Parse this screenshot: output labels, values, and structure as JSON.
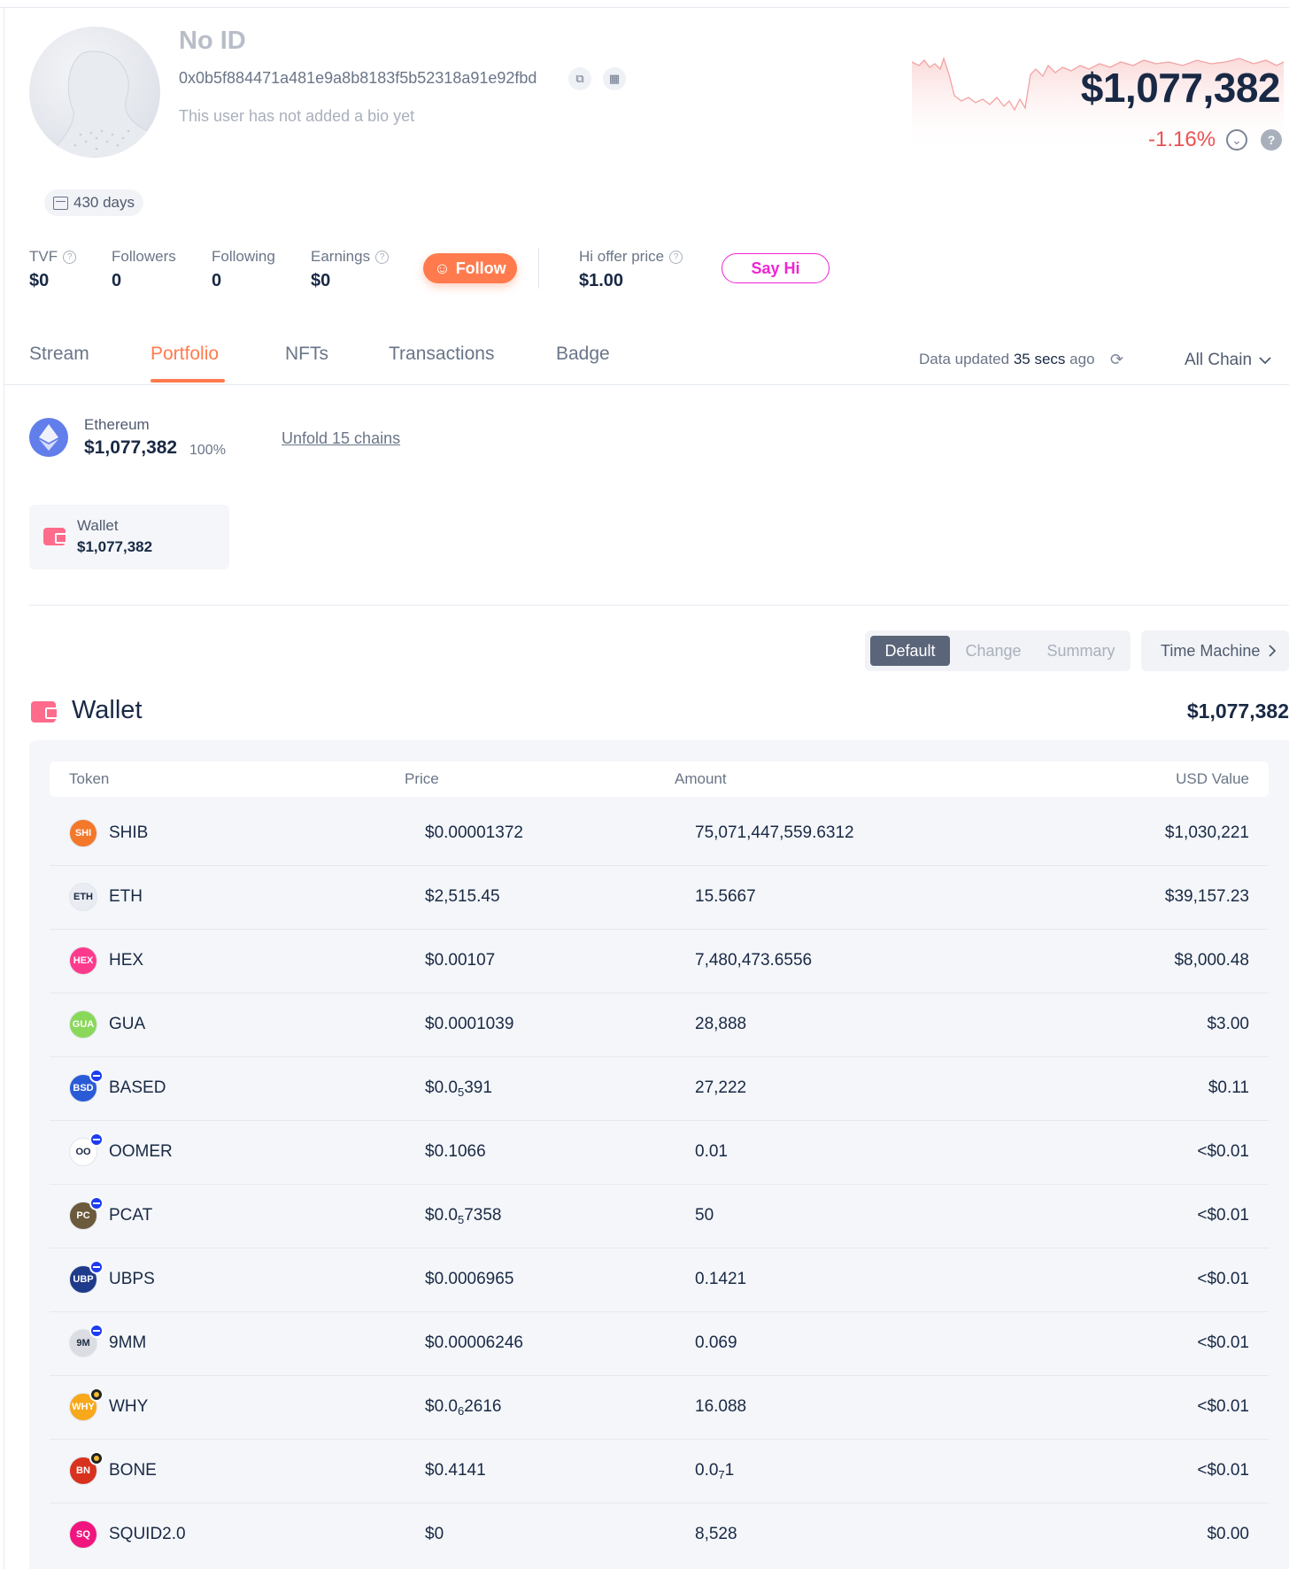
{
  "profile": {
    "name": "No ID",
    "address": "0x0b5f884471a481e9a8b8183f5b52318a91e92fbd",
    "bio": "This user has not added a bio yet",
    "days": "430 days",
    "total_value": "$1,077,382",
    "change": "-1.16%"
  },
  "stats": {
    "tvf_label": "TVF",
    "tvf_value": "$0",
    "followers_label": "Followers",
    "followers_value": "0",
    "following_label": "Following",
    "following_value": "0",
    "earnings_label": "Earnings",
    "earnings_value": "$0",
    "follow_label": "Follow",
    "hi_offer_label": "Hi offer price",
    "hi_offer_value": "$1.00",
    "sayhi_label": "Say Hi"
  },
  "tabs": [
    {
      "label": "Stream"
    },
    {
      "label": "Portfolio"
    },
    {
      "label": "NFTs"
    },
    {
      "label": "Transactions"
    },
    {
      "label": "Badge"
    }
  ],
  "data_updated": {
    "prefix": "Data updated",
    "value": "35 secs",
    "suffix": "ago"
  },
  "chain_filter": "All Chain",
  "chain_summary": {
    "name": "Ethereum",
    "value": "$1,077,382",
    "percent": "100%",
    "unfold_link": "Unfold 15 chains"
  },
  "wallet_card": {
    "label": "Wallet",
    "value": "$1,077,382"
  },
  "view_toggle": {
    "default": "Default",
    "change": "Change",
    "summary": "Summary",
    "time_machine": "Time Machine"
  },
  "wallet_section": {
    "title": "Wallet",
    "total": "$1,077,382"
  },
  "table": {
    "headers": {
      "token": "Token",
      "price": "Price",
      "amount": "Amount",
      "usd": "USD Value"
    },
    "rows": [
      {
        "token": "SHIB",
        "price": "$0.00001372",
        "amount": "75,071,447,559.6312",
        "usd": "$1,030,221",
        "icon_color": "#f4782a",
        "icon_label": "SHIB",
        "badge": ""
      },
      {
        "token": "ETH",
        "price": "$2,515.45",
        "amount": "15.5667",
        "usd": "$39,157.23",
        "icon_color": "#e9ecf2",
        "icon_label": "ETH",
        "badge": ""
      },
      {
        "token": "HEX",
        "price": "$0.00107",
        "amount": "7,480,473.6556",
        "usd": "$8,000.48",
        "icon_color": "#ff3a8c",
        "icon_label": "HEX",
        "badge": ""
      },
      {
        "token": "GUA",
        "price": "$0.0001039",
        "amount": "28,888",
        "usd": "$3.00",
        "icon_color": "#8ad85a",
        "icon_label": "GUA",
        "badge": ""
      },
      {
        "token": "BASED",
        "price_prefix": "$0.0",
        "price_sub": "5",
        "price_suffix": "391",
        "amount": "27,222",
        "usd": "$0.11",
        "icon_color": "#2a5bd7",
        "icon_label": "BSD",
        "badge": "blue"
      },
      {
        "token": "OOMER",
        "price": "$0.1066",
        "amount": "0.01",
        "usd": "<$0.01",
        "icon_color": "#ffffff",
        "icon_label": "OO",
        "badge": "blue"
      },
      {
        "token": "PCAT",
        "price_prefix": "$0.0",
        "price_sub": "5",
        "price_suffix": "7358",
        "amount": "50",
        "usd": "<$0.01",
        "icon_color": "#6b5a3b",
        "icon_label": "PC",
        "badge": "blue"
      },
      {
        "token": "UBPS",
        "price": "$0.0006965",
        "amount": "0.1421",
        "usd": "<$0.01",
        "icon_color": "#1e3a8a",
        "icon_label": "UBPS",
        "badge": "blue"
      },
      {
        "token": "9MM",
        "price": "$0.00006246",
        "amount": "0.069",
        "usd": "<$0.01",
        "icon_color": "#dcdde3",
        "icon_label": "9M",
        "badge": "blue"
      },
      {
        "token": "WHY",
        "price_prefix": "$0.0",
        "price_sub": "6",
        "price_suffix": "2616",
        "amount": "16.088",
        "usd": "<$0.01",
        "icon_color": "#f7a81b",
        "icon_label": "WHY",
        "badge": "dark"
      },
      {
        "token": "BONE",
        "price": "$0.4141",
        "amount_prefix": "0.0",
        "amount_sub": "7",
        "amount_suffix": "1",
        "usd": "<$0.01",
        "icon_color": "#d8321f",
        "icon_label": "BN",
        "badge": "dark"
      },
      {
        "token": "SQUID2.0",
        "price": "$0",
        "amount": "8,528",
        "usd": "$0.00",
        "icon_color": "#f0167e",
        "icon_label": "SQ",
        "badge": ""
      }
    ]
  },
  "colors": {
    "accent": "#ff7b4d",
    "negative": "#ec5151",
    "sayhi": "#f024d2",
    "text": "#192945"
  }
}
